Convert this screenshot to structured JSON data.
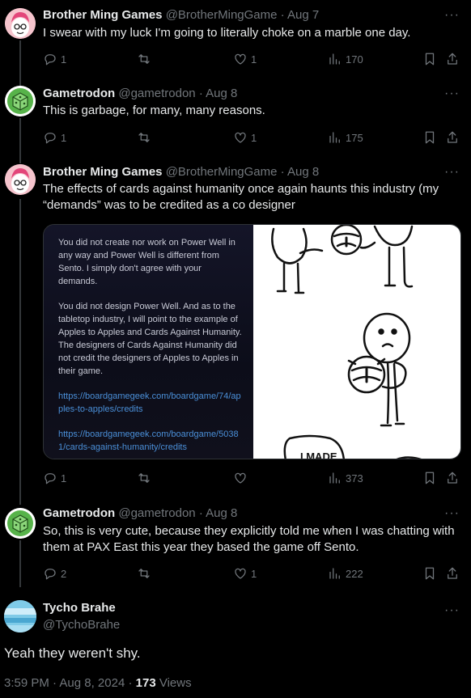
{
  "tweets": [
    {
      "name": "Brother Ming Games",
      "handle": "@BrotherMingGame",
      "separator": "·",
      "date": "Aug 7",
      "text": "I swear with my luck I'm going to literally choke on a marble one day.",
      "replies": "1",
      "retweets": "",
      "likes": "1",
      "views": "170",
      "avatar_icon": "brother-ming-avatar"
    },
    {
      "name": "Gametrodon",
      "handle": "@gametrodon",
      "separator": "·",
      "date": "Aug 8",
      "text": "This is garbage, for many, many reasons.",
      "replies": "1",
      "retweets": "",
      "likes": "1",
      "views": "175",
      "avatar_icon": "gametrodon-dice-avatar"
    },
    {
      "name": "Brother Ming Games",
      "handle": "@BrotherMingGame",
      "separator": "·",
      "date": "Aug 8",
      "text": "The effects of cards against humanity once again haunts this industry (my “demands” was to be credited as a co designer",
      "replies": "1",
      "retweets": "",
      "likes": "",
      "views": "373",
      "avatar_icon": "brother-ming-avatar",
      "media": {
        "paragraphs": [
          "You did not create nor work on Power Well in any way and Power Well is different from Sento.  I simply don't agree with your demands.",
          "You did not design Power Well.  And as to the tabletop industry, I will point to the example of Apples to Apples and Cards Against Humanity. The designers of Cards Against Humanity did not credit the designers of Apples to Apples in their game.",
          "https://boardgamegeek.com/boardgame/74/apples-to-apples/credits",
          "https://boardgamegeek.com/boardgame/50381/cards-against-humanity/credits"
        ],
        "comic_text": "I MADE"
      }
    },
    {
      "name": "Gametrodon",
      "handle": "@gametrodon",
      "separator": "·",
      "date": "Aug 8",
      "text": "So, this is very cute, because they explicitly told me when I was chatting with them at PAX East this year they based the game off Sento.",
      "replies": "2",
      "retweets": "",
      "likes": "1",
      "views": "222",
      "avatar_icon": "gametrodon-dice-avatar"
    }
  ],
  "main_tweet": {
    "name": "Tycho Brahe",
    "handle": "@TychoBrahe",
    "text": "Yeah they weren't shy.",
    "time": "3:59 PM",
    "separator": "·",
    "date": "Aug 8, 2024",
    "separator2": "·",
    "views_count": "173",
    "views_label": "Views"
  },
  "colors": {
    "background": "#000000",
    "text": "#e7e9ea",
    "muted": "#71767b",
    "link": "#4a8fd8",
    "border": "#2f3336"
  }
}
